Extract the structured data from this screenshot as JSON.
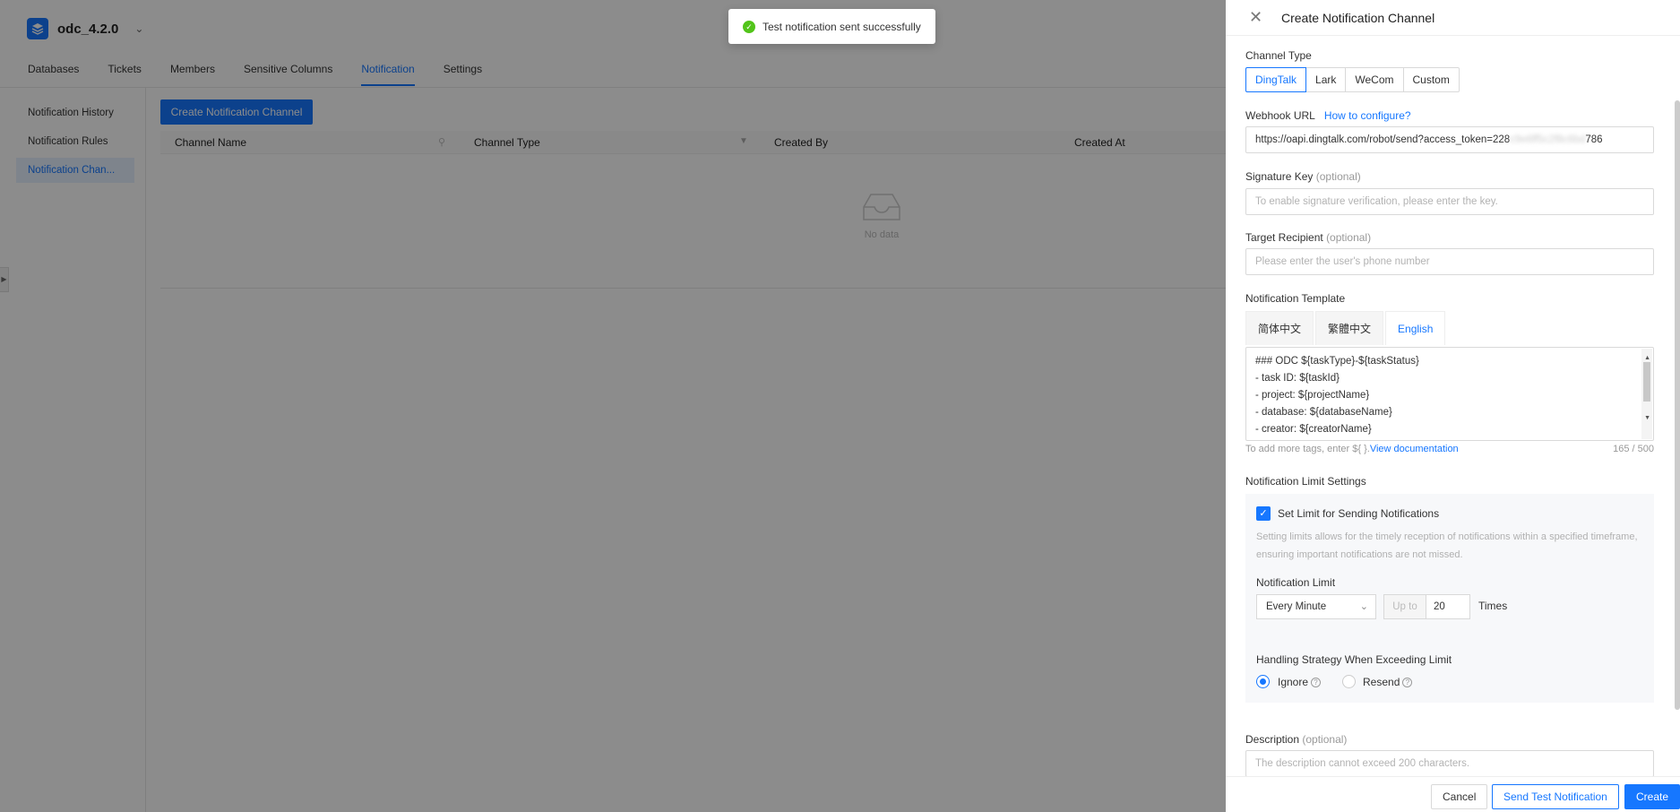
{
  "project": {
    "name": "odc_4.2.0"
  },
  "main_tabs": [
    "Databases",
    "Tickets",
    "Members",
    "Sensitive Columns",
    "Notification",
    "Settings"
  ],
  "sub_nav": [
    "Notification History",
    "Notification Rules",
    "Notification Chan..."
  ],
  "create_channel_button": "Create Notification Channel",
  "table": {
    "columns": [
      "Channel Name",
      "Channel Type",
      "Created By",
      "Created At"
    ],
    "empty_text": "No data"
  },
  "toast": {
    "message": "Test notification sent successfully"
  },
  "drawer": {
    "title": "Create Notification Channel",
    "channel_type": {
      "label": "Channel Type",
      "options": [
        "DingTalk",
        "Lark",
        "WeCom",
        "Custom"
      ],
      "selected": "DingTalk"
    },
    "webhook": {
      "label": "Webhook URL",
      "help_link": "How to configure?",
      "value_prefix": "https://oapi.dingtalk.com/robot/send?access_token=228",
      "value_suffix": "786"
    },
    "signature_key": {
      "label": "Signature Key",
      "optional": "(optional)",
      "placeholder": "To enable signature verification, please enter the key."
    },
    "target_recipient": {
      "label": "Target Recipient",
      "optional": "(optional)",
      "placeholder": "Please enter the user's phone number"
    },
    "template": {
      "label": "Notification Template",
      "tabs": [
        "简体中文",
        "繁體中文",
        "English"
      ],
      "active_tab": "English",
      "lines": [
        "### ODC ${taskType}-${taskStatus}",
        "- task ID: ${taskId}",
        "- project: ${projectName}",
        "- database: ${databaseName}",
        "- creator: ${creatorName}"
      ],
      "hint": "To add more tags, enter ${ }.",
      "hint_link": "View documentation",
      "counter": "165 / 500"
    },
    "limit": {
      "section_label": "Notification Limit Settings",
      "checkbox_label": "Set Limit for Sending Notifications",
      "checked": true,
      "description": "Setting limits allows for the timely reception of notifications within a specified timeframe, ensuring important notifications are not missed.",
      "limit_label": "Notification Limit",
      "frequency": "Every Minute",
      "up_to": "Up to",
      "count": "20",
      "times": "Times",
      "strategy_label": "Handling Strategy When Exceeding Limit",
      "strategies": [
        "Ignore",
        "Resend"
      ],
      "selected_strategy": "Ignore"
    },
    "description": {
      "label": "Description",
      "optional": "(optional)",
      "placeholder": "The description cannot exceed 200 characters."
    },
    "footer": {
      "cancel": "Cancel",
      "send_test": "Send Test Notification",
      "create": "Create"
    }
  },
  "colors": {
    "primary": "#1677ff",
    "success": "#52c41a"
  }
}
